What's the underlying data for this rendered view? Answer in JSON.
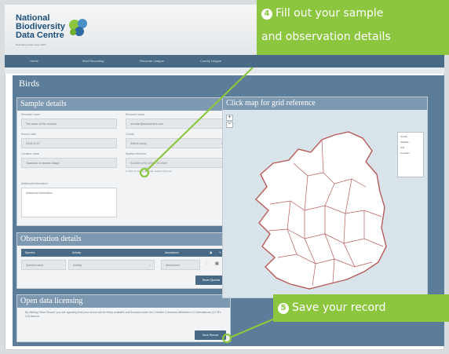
{
  "logo": {
    "line1": "National",
    "line2": "Biodiversity",
    "line3": "Data Centre",
    "sub": "Recording nature since 2007"
  },
  "nav": {
    "items": [
      "Home",
      "Start Recording",
      "Recorder League",
      "County League"
    ]
  },
  "page": {
    "title": "Birds"
  },
  "sample": {
    "heading": "Sample details",
    "recorder_name_label": "Recorder name",
    "recorder_name_value": "The name of the recorder",
    "recorder_email_label": "Recorder email",
    "recorder_email_value": "recorder@somewhere.com",
    "record_date_label": "Record date",
    "record_date_value": "2018-10-07",
    "county_label": "County",
    "county_value": "Select county",
    "location_label": "Location name",
    "location_value": "Townland or nearest village",
    "spatial_label": "Spatial reference",
    "spatial_value": "S12345 or 51.12345,-9.12345",
    "spatial_hint": "Click on map to generate spatial reference",
    "additional_label": "Additional information",
    "additional_placeholder": "Additional information"
  },
  "observation": {
    "heading": "Observation details",
    "columns": [
      "Species",
      "Activity",
      "Abundance"
    ],
    "row": {
      "species": "Species name",
      "activity": "Activity",
      "abundance": "Abundance"
    },
    "reset_label": "Reset Species"
  },
  "licensing": {
    "heading": "Open data licensing",
    "text": "By clicking 'Save Record' you are agreeing that your record will be freely available and licensed under the Creative Commons Attribution 4.0 International (CC BY 4.0) licence.",
    "save_label": "Save Record"
  },
  "map": {
    "heading": "Click map for grid reference",
    "zoom_in": "+",
    "zoom_out": "−",
    "legend": [
      "Terrain",
      "Satellite",
      "OSi",
      "Counties"
    ]
  },
  "callouts": {
    "step4_number": "4",
    "step4_line1": "Fill out your sample",
    "step4_line2": "and observation details",
    "step5_number": "5",
    "step5_text": "Save your record"
  },
  "colors": {
    "accent_green": "#8cc63f",
    "header_blue": "#486a86",
    "panel_head": "#7d99b1",
    "county_border": "#b85a5a"
  }
}
